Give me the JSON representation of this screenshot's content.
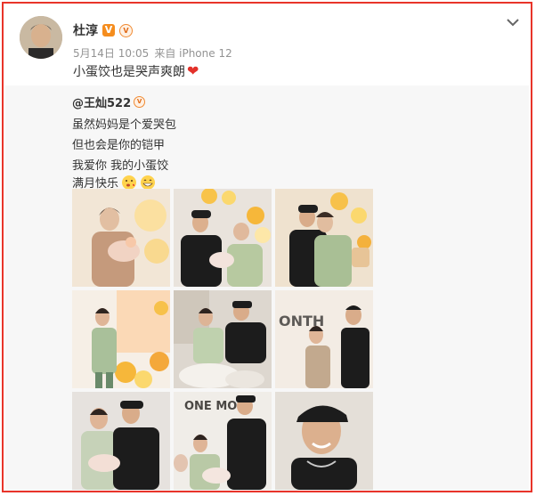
{
  "post": {
    "author": "杜淳",
    "verified_badge": "V",
    "svip_badge": "会员",
    "date": "5月14日 10:05",
    "source": "来自 iPhone 12",
    "text": "小蛋饺也是哭声爽朗",
    "text_emoji": "heart"
  },
  "repost": {
    "user": "@王灿522",
    "lines": [
      "虽然妈妈是个爱哭包",
      "但也会是你的铠甲",
      "我爱你 我的小蛋饺",
      "满月快乐"
    ],
    "emojis": [
      "kiss-emoji",
      "grin-emoji"
    ]
  },
  "photos": [
    {
      "desc": "mother-holding-baby"
    },
    {
      "desc": "couple-with-baby-balloons"
    },
    {
      "desc": "father-kissing-mother"
    },
    {
      "desc": "mother-standing-balloon-wall"
    },
    {
      "desc": "couple-sitting-with-baby"
    },
    {
      "desc": "couple-one-month-banner"
    },
    {
      "desc": "couple-close-with-baby"
    },
    {
      "desc": "family-one-month-sign"
    },
    {
      "desc": "father-smiling-cap"
    }
  ],
  "photo_text": {
    "month_sign": "ONTH",
    "one_month_sign": "ONE MON"
  },
  "colors": {
    "border": "#e8342a",
    "repost_bg": "#f7f7f7",
    "badge": "#f58d1e",
    "heart": "#e3312a"
  }
}
